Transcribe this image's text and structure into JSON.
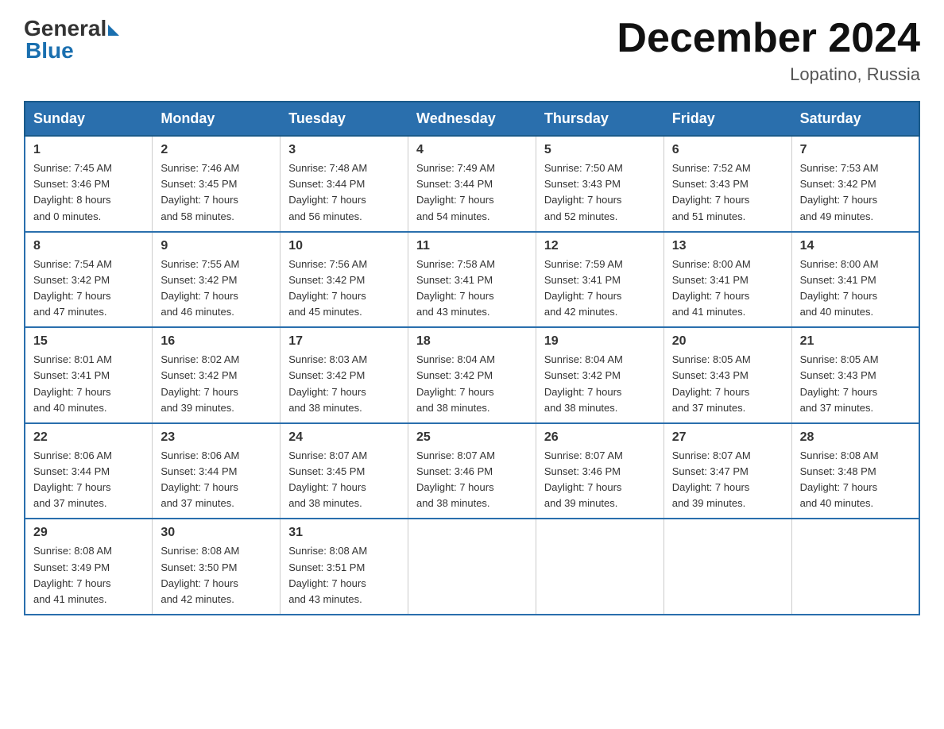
{
  "header": {
    "logo_general": "General",
    "logo_blue": "Blue",
    "month_title": "December 2024",
    "location": "Lopatino, Russia"
  },
  "days_of_week": [
    "Sunday",
    "Monday",
    "Tuesday",
    "Wednesday",
    "Thursday",
    "Friday",
    "Saturday"
  ],
  "weeks": [
    [
      {
        "day": "1",
        "sunrise": "Sunrise: 7:45 AM",
        "sunset": "Sunset: 3:46 PM",
        "daylight": "Daylight: 8 hours",
        "minutes": "and 0 minutes."
      },
      {
        "day": "2",
        "sunrise": "Sunrise: 7:46 AM",
        "sunset": "Sunset: 3:45 PM",
        "daylight": "Daylight: 7 hours",
        "minutes": "and 58 minutes."
      },
      {
        "day": "3",
        "sunrise": "Sunrise: 7:48 AM",
        "sunset": "Sunset: 3:44 PM",
        "daylight": "Daylight: 7 hours",
        "minutes": "and 56 minutes."
      },
      {
        "day": "4",
        "sunrise": "Sunrise: 7:49 AM",
        "sunset": "Sunset: 3:44 PM",
        "daylight": "Daylight: 7 hours",
        "minutes": "and 54 minutes."
      },
      {
        "day": "5",
        "sunrise": "Sunrise: 7:50 AM",
        "sunset": "Sunset: 3:43 PM",
        "daylight": "Daylight: 7 hours",
        "minutes": "and 52 minutes."
      },
      {
        "day": "6",
        "sunrise": "Sunrise: 7:52 AM",
        "sunset": "Sunset: 3:43 PM",
        "daylight": "Daylight: 7 hours",
        "minutes": "and 51 minutes."
      },
      {
        "day": "7",
        "sunrise": "Sunrise: 7:53 AM",
        "sunset": "Sunset: 3:42 PM",
        "daylight": "Daylight: 7 hours",
        "minutes": "and 49 minutes."
      }
    ],
    [
      {
        "day": "8",
        "sunrise": "Sunrise: 7:54 AM",
        "sunset": "Sunset: 3:42 PM",
        "daylight": "Daylight: 7 hours",
        "minutes": "and 47 minutes."
      },
      {
        "day": "9",
        "sunrise": "Sunrise: 7:55 AM",
        "sunset": "Sunset: 3:42 PM",
        "daylight": "Daylight: 7 hours",
        "minutes": "and 46 minutes."
      },
      {
        "day": "10",
        "sunrise": "Sunrise: 7:56 AM",
        "sunset": "Sunset: 3:42 PM",
        "daylight": "Daylight: 7 hours",
        "minutes": "and 45 minutes."
      },
      {
        "day": "11",
        "sunrise": "Sunrise: 7:58 AM",
        "sunset": "Sunset: 3:41 PM",
        "daylight": "Daylight: 7 hours",
        "minutes": "and 43 minutes."
      },
      {
        "day": "12",
        "sunrise": "Sunrise: 7:59 AM",
        "sunset": "Sunset: 3:41 PM",
        "daylight": "Daylight: 7 hours",
        "minutes": "and 42 minutes."
      },
      {
        "day": "13",
        "sunrise": "Sunrise: 8:00 AM",
        "sunset": "Sunset: 3:41 PM",
        "daylight": "Daylight: 7 hours",
        "minutes": "and 41 minutes."
      },
      {
        "day": "14",
        "sunrise": "Sunrise: 8:00 AM",
        "sunset": "Sunset: 3:41 PM",
        "daylight": "Daylight: 7 hours",
        "minutes": "and 40 minutes."
      }
    ],
    [
      {
        "day": "15",
        "sunrise": "Sunrise: 8:01 AM",
        "sunset": "Sunset: 3:41 PM",
        "daylight": "Daylight: 7 hours",
        "minutes": "and 40 minutes."
      },
      {
        "day": "16",
        "sunrise": "Sunrise: 8:02 AM",
        "sunset": "Sunset: 3:42 PM",
        "daylight": "Daylight: 7 hours",
        "minutes": "and 39 minutes."
      },
      {
        "day": "17",
        "sunrise": "Sunrise: 8:03 AM",
        "sunset": "Sunset: 3:42 PM",
        "daylight": "Daylight: 7 hours",
        "minutes": "and 38 minutes."
      },
      {
        "day": "18",
        "sunrise": "Sunrise: 8:04 AM",
        "sunset": "Sunset: 3:42 PM",
        "daylight": "Daylight: 7 hours",
        "minutes": "and 38 minutes."
      },
      {
        "day": "19",
        "sunrise": "Sunrise: 8:04 AM",
        "sunset": "Sunset: 3:42 PM",
        "daylight": "Daylight: 7 hours",
        "minutes": "and 38 minutes."
      },
      {
        "day": "20",
        "sunrise": "Sunrise: 8:05 AM",
        "sunset": "Sunset: 3:43 PM",
        "daylight": "Daylight: 7 hours",
        "minutes": "and 37 minutes."
      },
      {
        "day": "21",
        "sunrise": "Sunrise: 8:05 AM",
        "sunset": "Sunset: 3:43 PM",
        "daylight": "Daylight: 7 hours",
        "minutes": "and 37 minutes."
      }
    ],
    [
      {
        "day": "22",
        "sunrise": "Sunrise: 8:06 AM",
        "sunset": "Sunset: 3:44 PM",
        "daylight": "Daylight: 7 hours",
        "minutes": "and 37 minutes."
      },
      {
        "day": "23",
        "sunrise": "Sunrise: 8:06 AM",
        "sunset": "Sunset: 3:44 PM",
        "daylight": "Daylight: 7 hours",
        "minutes": "and 37 minutes."
      },
      {
        "day": "24",
        "sunrise": "Sunrise: 8:07 AM",
        "sunset": "Sunset: 3:45 PM",
        "daylight": "Daylight: 7 hours",
        "minutes": "and 38 minutes."
      },
      {
        "day": "25",
        "sunrise": "Sunrise: 8:07 AM",
        "sunset": "Sunset: 3:46 PM",
        "daylight": "Daylight: 7 hours",
        "minutes": "and 38 minutes."
      },
      {
        "day": "26",
        "sunrise": "Sunrise: 8:07 AM",
        "sunset": "Sunset: 3:46 PM",
        "daylight": "Daylight: 7 hours",
        "minutes": "and 39 minutes."
      },
      {
        "day": "27",
        "sunrise": "Sunrise: 8:07 AM",
        "sunset": "Sunset: 3:47 PM",
        "daylight": "Daylight: 7 hours",
        "minutes": "and 39 minutes."
      },
      {
        "day": "28",
        "sunrise": "Sunrise: 8:08 AM",
        "sunset": "Sunset: 3:48 PM",
        "daylight": "Daylight: 7 hours",
        "minutes": "and 40 minutes."
      }
    ],
    [
      {
        "day": "29",
        "sunrise": "Sunrise: 8:08 AM",
        "sunset": "Sunset: 3:49 PM",
        "daylight": "Daylight: 7 hours",
        "minutes": "and 41 minutes."
      },
      {
        "day": "30",
        "sunrise": "Sunrise: 8:08 AM",
        "sunset": "Sunset: 3:50 PM",
        "daylight": "Daylight: 7 hours",
        "minutes": "and 42 minutes."
      },
      {
        "day": "31",
        "sunrise": "Sunrise: 8:08 AM",
        "sunset": "Sunset: 3:51 PM",
        "daylight": "Daylight: 7 hours",
        "minutes": "and 43 minutes."
      },
      {
        "day": "",
        "sunrise": "",
        "sunset": "",
        "daylight": "",
        "minutes": ""
      },
      {
        "day": "",
        "sunrise": "",
        "sunset": "",
        "daylight": "",
        "minutes": ""
      },
      {
        "day": "",
        "sunrise": "",
        "sunset": "",
        "daylight": "",
        "minutes": ""
      },
      {
        "day": "",
        "sunrise": "",
        "sunset": "",
        "daylight": "",
        "minutes": ""
      }
    ]
  ]
}
